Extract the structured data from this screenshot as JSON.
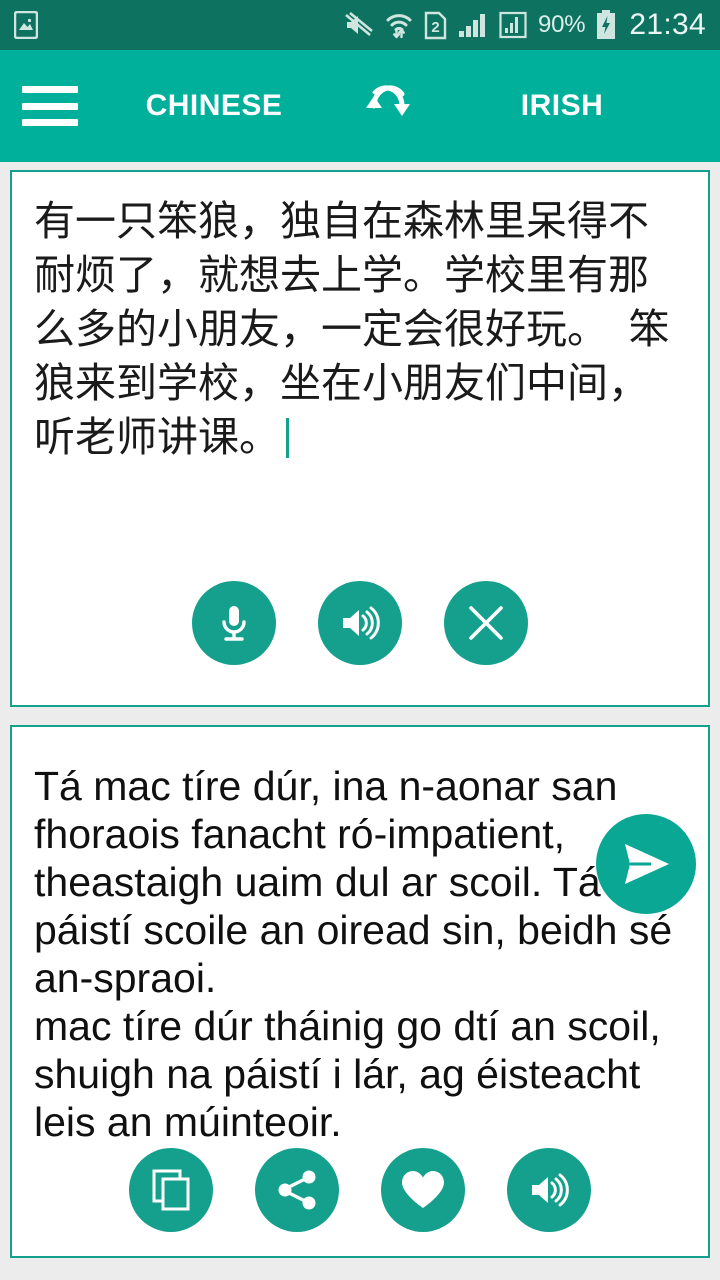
{
  "status_bar": {
    "notification_icon": "image-notification-icon",
    "icons": [
      "mute-icon",
      "wifi-transfer-icon",
      "sim2-icon",
      "signal-bars-icon",
      "signal-bars-2-icon"
    ],
    "battery_percent": "90%",
    "battery_icon": "battery-charging-icon",
    "time": "21:34",
    "background_color": "#0e7261"
  },
  "app_bar": {
    "menu_icon": "hamburger-menu-icon",
    "source_language": "CHINESE",
    "swap_icon": "swap-languages-icon",
    "target_language": "IRISH",
    "background_color": "#00b09b"
  },
  "source_card": {
    "text": "有一只笨狼，独自在森林里呆得不耐烦了，就想去上学。学校里有那么多的小朋友，一定会很好玩。　笨狼来到学校，坐在小朋友们中间，听老师讲课。",
    "caret_visible": true,
    "buttons": [
      {
        "name": "microphone-button",
        "icon": "microphone-icon",
        "label": "Speak"
      },
      {
        "name": "speak-source-button",
        "icon": "speaker-icon",
        "label": "Listen"
      },
      {
        "name": "clear-button",
        "icon": "close-icon",
        "label": "Clear"
      }
    ]
  },
  "translate_button": {
    "icon": "send-icon",
    "label": "Translate",
    "color": "#0aa795"
  },
  "target_card": {
    "text": "Tá mac tíre dúr, ina n-aonar san fhoraois fanacht ró-impatient, theastaigh uaim dul ar scoil. Tá páistí scoile an oiread sin, beidh sé an-spraoi.\nmac tíre dúr tháinig go dtí an scoil, shuigh na páistí i lár, ag éisteacht leis an múinteoir.",
    "buttons": [
      {
        "name": "copy-button",
        "icon": "copy-icon",
        "label": "Copy"
      },
      {
        "name": "share-button",
        "icon": "share-icon",
        "label": "Share"
      },
      {
        "name": "favorite-button",
        "icon": "heart-icon",
        "label": "Favorite"
      },
      {
        "name": "speak-target-button",
        "icon": "speaker-icon",
        "label": "Listen"
      }
    ]
  },
  "theme": {
    "accent": "#00b09b",
    "accent_dark": "#0e7261",
    "button_teal": "#14a08c",
    "page_background": "#ececec"
  }
}
